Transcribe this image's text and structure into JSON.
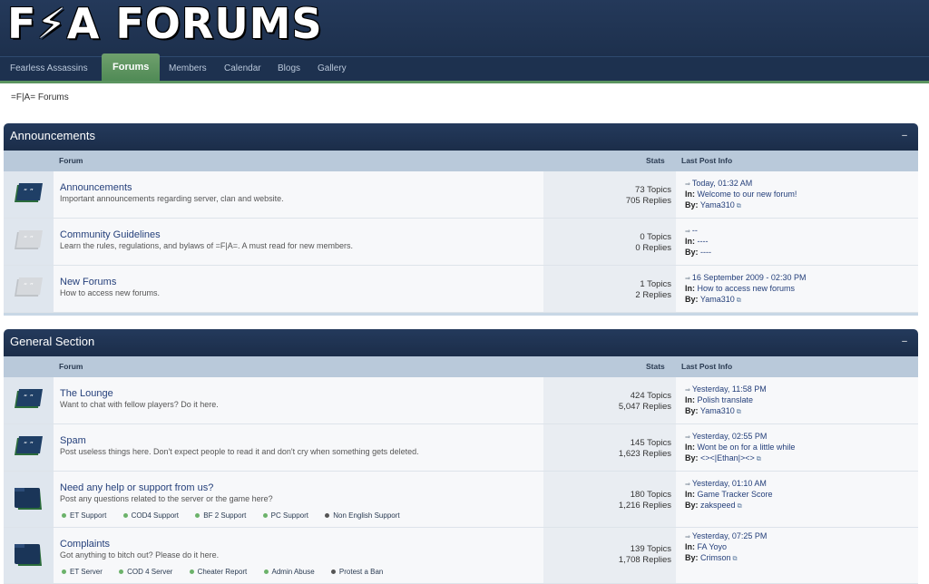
{
  "header": {
    "logo_text_left": "F",
    "logo_bolt": "⚡",
    "logo_text_right": "A FORUMS"
  },
  "nav": [
    {
      "label": "Fearless Assassins"
    },
    {
      "label": "Forums"
    },
    {
      "label": "Members"
    },
    {
      "label": "Calendar"
    },
    {
      "label": "Blogs"
    },
    {
      "label": "Gallery"
    }
  ],
  "breadcrumb": "=F|A= Forums",
  "columns": {
    "forum": "Forum",
    "stats": "Stats",
    "last": "Last Post Info"
  },
  "sections": [
    {
      "title": "Announcements",
      "collapse": "–",
      "rows": [
        {
          "title": "Announcements",
          "desc": "Important announcements regarding server, clan and website.",
          "topics": "73 Topics",
          "replies": "705 Replies",
          "when": "Today, 01:32 AM",
          "in_label": "In:",
          "in": "Welcome to our new forum!",
          "by_label": "By:",
          "by": "Yama310"
        },
        {
          "title": "Community Guidelines",
          "desc": "Learn the rules, regulations, and bylaws of =F|A=. A must read for new members.",
          "topics": "0 Topics",
          "replies": "0 Replies",
          "when": "--",
          "in_label": "In:",
          "in": "----",
          "by_label": "By:",
          "by": "----"
        },
        {
          "title": "New Forums",
          "desc": "How to access new forums.",
          "topics": "1 Topics",
          "replies": "2 Replies",
          "when": "16 September 2009 - 02:30 PM",
          "in_label": "In:",
          "in": "How to access new forums",
          "by_label": "By:",
          "by": "Yama310"
        }
      ]
    },
    {
      "title": "General Section",
      "collapse": "–",
      "rows": [
        {
          "title": "The Lounge",
          "desc": "Want to chat with fellow players? Do it here.",
          "topics": "424 Topics",
          "replies": "5,047 Replies",
          "when": "Yesterday, 11:58 PM",
          "in_label": "In:",
          "in": "Polish translate",
          "by_label": "By:",
          "by": "Yama310"
        },
        {
          "title": "Spam",
          "desc": "Post useless things here. Don't expect people to read it and don't cry when something gets deleted.",
          "topics": "145 Topics",
          "replies": "1,623 Replies",
          "when": "Yesterday, 02:55 PM",
          "in_label": "In:",
          "in": "Wont be on for a little while",
          "by_label": "By:",
          "by": "<><|Ethan|><>"
        },
        {
          "title": "Need any help or support from us?",
          "desc": "Post any questions related to the server or the game here?",
          "topics": "180 Topics",
          "replies": "1,216 Replies",
          "when": "Yesterday, 01:10 AM",
          "in_label": "In:",
          "in": "Game Tracker Score",
          "by_label": "By:",
          "by": "zakspeed",
          "subs": [
            "ET Support",
            "COD4 Support",
            "BF 2 Support",
            "PC Support",
            "Non English Support"
          ]
        },
        {
          "title": "Complaints",
          "desc": "Got anything to bitch out? Please do it here.",
          "topics": "139 Topics",
          "replies": "1,708 Replies",
          "when": "Yesterday, 07:25 PM",
          "in_label": "In:",
          "in": "FA Yoyo",
          "by_label": "By:",
          "by": "Crimson",
          "subs": [
            "ET Server",
            "COD 4 Server",
            "Cheater Report",
            "Admin Abuse",
            "Protest a Ban"
          ]
        }
      ]
    }
  ],
  "colors": {
    "header": "#1b2d49",
    "active_tab": "#5b9460",
    "link": "#243f7a"
  }
}
